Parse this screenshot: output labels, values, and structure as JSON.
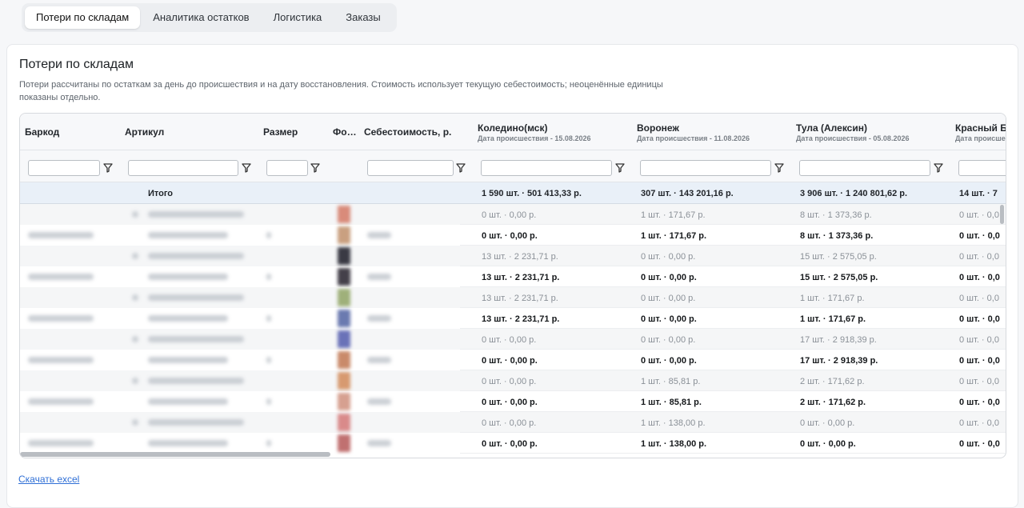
{
  "tabs": [
    "Потери по складам",
    "Аналитика остатков",
    "Логистика",
    "Заказы"
  ],
  "page": {
    "title": "Потери по складам",
    "description": "Потери рассчитаны по остаткам за день до происшествия и на дату восстановления. Стоимость использует текущую себестоимость; неоценённые единицы показаны отдельно.",
    "download": "Скачать excel"
  },
  "columns": {
    "barcode": "Баркод",
    "article": "Артикул",
    "size": "Размер",
    "photo": "Фо…",
    "cost": "Себестоимость, р."
  },
  "warehouses": [
    {
      "name": "Коледино(мск)",
      "date": "Дата происшествия - 15.08.2026",
      "total": "1 590 шт. · 501 413,33 р."
    },
    {
      "name": "Воронеж",
      "date": "Дата происшествия - 11.08.2026",
      "total": "307 шт. · 143 201,16 р."
    },
    {
      "name": "Тула (Алексин)",
      "date": "Дата происшествия - 05.08.2026",
      "total": "3 906 шт. · 1 240 801,62 р."
    },
    {
      "name": "Красный Бо",
      "date": "Дата происше",
      "total": "14 шт. · 7"
    }
  ],
  "total_label": "Итого",
  "rows": [
    {
      "type": "light",
      "v": [
        "0 шт. · 0,00 р.",
        "1 шт. · 171,67 р.",
        "8 шт. · 1 373,36 р.",
        "0 шт. · 0,0"
      ]
    },
    {
      "type": "bold",
      "v": [
        "0 шт. · 0,00 р.",
        "1 шт. · 171,67 р.",
        "8 шт. · 1 373,36 р.",
        "0 шт. · 0,0"
      ]
    },
    {
      "type": "light",
      "v": [
        "13 шт. · 2 231,71 р.",
        "0 шт. · 0,00 р.",
        "15 шт. · 2 575,05 р.",
        "0 шт. · 0,0"
      ]
    },
    {
      "type": "bold",
      "v": [
        "13 шт. · 2 231,71 р.",
        "0 шт. · 0,00 р.",
        "15 шт. · 2 575,05 р.",
        "0 шт. · 0,0"
      ]
    },
    {
      "type": "light",
      "v": [
        "13 шт. · 2 231,71 р.",
        "0 шт. · 0,00 р.",
        "1 шт. · 171,67 р.",
        "0 шт. · 0,0"
      ]
    },
    {
      "type": "bold",
      "v": [
        "13 шт. · 2 231,71 р.",
        "0 шт. · 0,00 р.",
        "1 шт. · 171,67 р.",
        "0 шт. · 0,0"
      ]
    },
    {
      "type": "light",
      "v": [
        "0 шт. · 0,00 р.",
        "0 шт. · 0,00 р.",
        "17 шт. · 2 918,39 р.",
        "0 шт. · 0,0"
      ]
    },
    {
      "type": "bold",
      "v": [
        "0 шт. · 0,00 р.",
        "0 шт. · 0,00 р.",
        "17 шт. · 2 918,39 р.",
        "0 шт. · 0,0"
      ]
    },
    {
      "type": "light",
      "v": [
        "0 шт. · 0,00 р.",
        "1 шт. · 85,81 р.",
        "2 шт. · 171,62 р.",
        "0 шт. · 0,0"
      ]
    },
    {
      "type": "bold",
      "v": [
        "0 шт. · 0,00 р.",
        "1 шт. · 85,81 р.",
        "2 шт. · 171,62 р.",
        "0 шт. · 0,0"
      ]
    },
    {
      "type": "light",
      "v": [
        "0 шт. · 0,00 р.",
        "1 шт. · 138,00 р.",
        "0 шт. · 0,00 р.",
        "0 шт. · 0,0"
      ]
    },
    {
      "type": "bold",
      "v": [
        "0 шт. · 0,00 р.",
        "1 шт. · 138,00 р.",
        "0 шт. · 0,00 р.",
        "0 шт. · 0,0"
      ]
    }
  ],
  "colors": {
    "accent": "#2f6fd6",
    "total_bg": "#e9f0f8"
  }
}
